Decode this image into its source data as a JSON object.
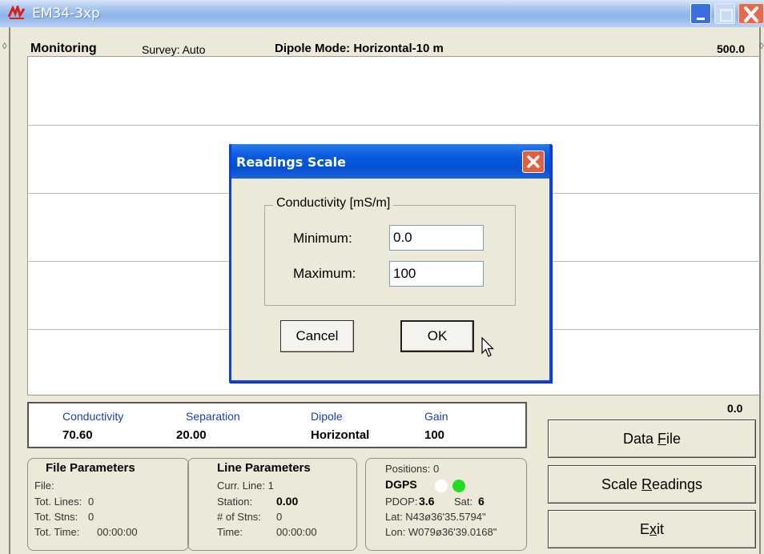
{
  "window": {
    "title": "EM34-3xp"
  },
  "header": {
    "mode": "Monitoring",
    "survey": "Survey: Auto",
    "dipole_mode": "Dipole Mode: Horizontal-10 m",
    "scale_max": "500.0",
    "scale_min": "0.0"
  },
  "readout": {
    "conductivity_label": "Conductivity",
    "conductivity_value": "70.60",
    "separation_label": "Separation",
    "separation_value": "20.00",
    "dipole_label": "Dipole",
    "dipole_value": "Horizontal",
    "gain_label": "Gain",
    "gain_value": "100",
    "label_color": "#1a3fb0"
  },
  "file_params": {
    "title": "File Parameters",
    "file": "File:",
    "tot_lines_label": "Tot. Lines:",
    "tot_lines": "0",
    "tot_stns_label": "Tot. Stns:",
    "tot_stns": "0",
    "tot_time_label": "Tot. Time:",
    "tot_time": "00:00:00"
  },
  "line_params": {
    "title": "Line Parameters",
    "curr_line": "Curr. Line: 1",
    "station_label": "Station:",
    "station": "0.00",
    "num_stns_label": "# of Stns:",
    "num_stns": "0",
    "time_label": "Time:",
    "time": "00:00:00"
  },
  "gps": {
    "positions": "Positions: 0",
    "dgps_label": "DGPS",
    "pdop_label": "PDOP:",
    "pdop": "3.6",
    "sat_label": "Sat:",
    "sat": "6",
    "lat": "Lat:  N43ø36'35.5794\"",
    "lon": "Lon: W079ø36'39.0168\"",
    "indicator_colors": [
      "#ffffff",
      "#22dd22"
    ]
  },
  "buttons": {
    "data_file_pre": "Data ",
    "data_file_key": "F",
    "data_file_post": "ile",
    "scale_pre": "Scale ",
    "scale_key": "R",
    "scale_post": "eadings",
    "exit_pre": "E",
    "exit_key": "x",
    "exit_post": "it"
  },
  "dialog": {
    "title": "Readings Scale",
    "group_title": "Conductivity [mS/m]",
    "min_label": "Minimum:",
    "min_value": "0.0",
    "max_label": "Maximum:",
    "max_value": "100",
    "cancel": "Cancel",
    "ok": "OK"
  },
  "colors": {
    "titlebar": "#8db4ea",
    "dialog_titlebar": "#0a5ae0",
    "close_red": "#e2603f"
  }
}
